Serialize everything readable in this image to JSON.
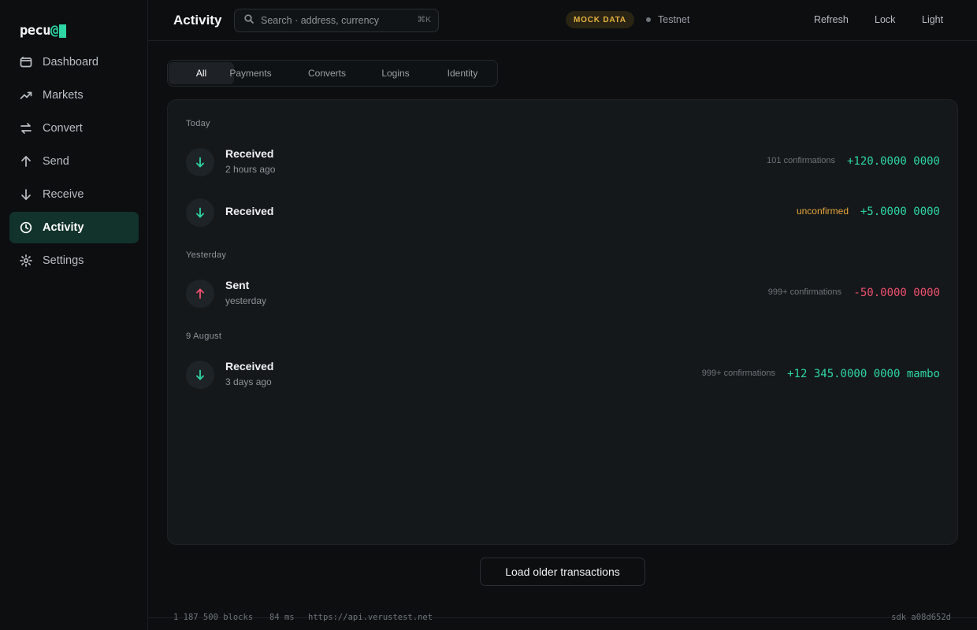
{
  "app": {
    "logo_text": "pecu",
    "logo_at": "@"
  },
  "sidebar": {
    "items": [
      {
        "label": "Dashboard",
        "icon": "wallet-icon"
      },
      {
        "label": "Markets",
        "icon": "trend-up-icon"
      },
      {
        "label": "Convert",
        "icon": "swap-icon"
      },
      {
        "label": "Send",
        "icon": "arrow-up-icon"
      },
      {
        "label": "Receive",
        "icon": "arrow-down-icon"
      },
      {
        "label": "Activity",
        "icon": "clock-icon",
        "active": true
      },
      {
        "label": "Settings",
        "icon": "gear-icon"
      }
    ]
  },
  "header": {
    "title": "Activity",
    "search_placeholder": "Search · address, currency",
    "search_shortcut": "⌘K",
    "mock_badge": "MOCK DATA",
    "network": "Testnet",
    "refresh": "Refresh",
    "lock": "Lock",
    "theme": "Light"
  },
  "tabs": [
    "All",
    "Payments",
    "Converts",
    "Logins",
    "Identity"
  ],
  "groups": [
    {
      "label": "Today",
      "transactions": [
        {
          "title": "Received",
          "subtitle": "2 hours ago",
          "confirmations": "101 confirmations",
          "amount": "+120.0000 0000",
          "direction": "in"
        },
        {
          "title": "Received",
          "subtitle": "",
          "confirmations": "unconfirmed",
          "amount": "+5.0000 0000",
          "direction": "in",
          "unconfirmed": true
        }
      ]
    },
    {
      "label": "Yesterday",
      "transactions": [
        {
          "title": "Sent",
          "subtitle": "yesterday",
          "confirmations": "999+ confirmations",
          "amount": "-50.0000 0000",
          "direction": "out"
        }
      ]
    },
    {
      "label": "9 August",
      "transactions": [
        {
          "title": "Received",
          "subtitle": "3 days ago",
          "confirmations": "999+ confirmations",
          "amount": "+12 345.0000 0000 mambo",
          "direction": "in"
        }
      ]
    }
  ],
  "load_more": "Load older transactions",
  "footer": {
    "blocks": "1 187 500 blocks",
    "latency": "84 ms",
    "api": "https://api.verustest.net",
    "sdk": "sdk a08d652d"
  },
  "colors": {
    "accent": "#2ed6a6",
    "negative": "#f0506e",
    "warning": "#e6a63a",
    "mock": "#e6b340"
  }
}
